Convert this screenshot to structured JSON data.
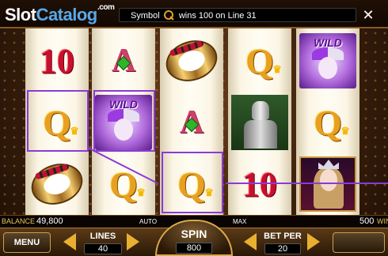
{
  "branding": {
    "logo_part1": "Slot",
    "logo_part2": "Catalog",
    "logo_suffix": ".com"
  },
  "message": {
    "prefix": "Symbol",
    "symbol_icon": "queen-q-icon",
    "suffix": "wins 100 on Line 31"
  },
  "close_label": "✕",
  "reels": [
    [
      "10",
      "ring",
      "Q"
    ],
    [
      "A",
      "WILD",
      "Q"
    ],
    [
      "ring",
      "A",
      "Q"
    ],
    [
      "Q",
      "knight",
      "10"
    ],
    [
      "WILD",
      "Q",
      "queen"
    ]
  ],
  "symbols": {
    "ten": "10",
    "ace": "A",
    "queen": "Q",
    "wild": "WILD"
  },
  "status": {
    "balance_label": "BALANCE",
    "balance_value": "49,800",
    "auto_label": "AUTO",
    "max_label": "MAX",
    "win_value": "500",
    "win_label": "WIN"
  },
  "controls": {
    "menu_label": "MENU",
    "lines_label": "LINES",
    "lines_value": "40",
    "spin_label": "SPIN",
    "spin_value": "800",
    "bet_label": "BET PER",
    "bet_value": "20"
  },
  "colors": {
    "win_line": "#8a3ad8",
    "accent": "#e8b030",
    "ten_red": "#c8102e",
    "queen_gold": "#e8a020"
  }
}
